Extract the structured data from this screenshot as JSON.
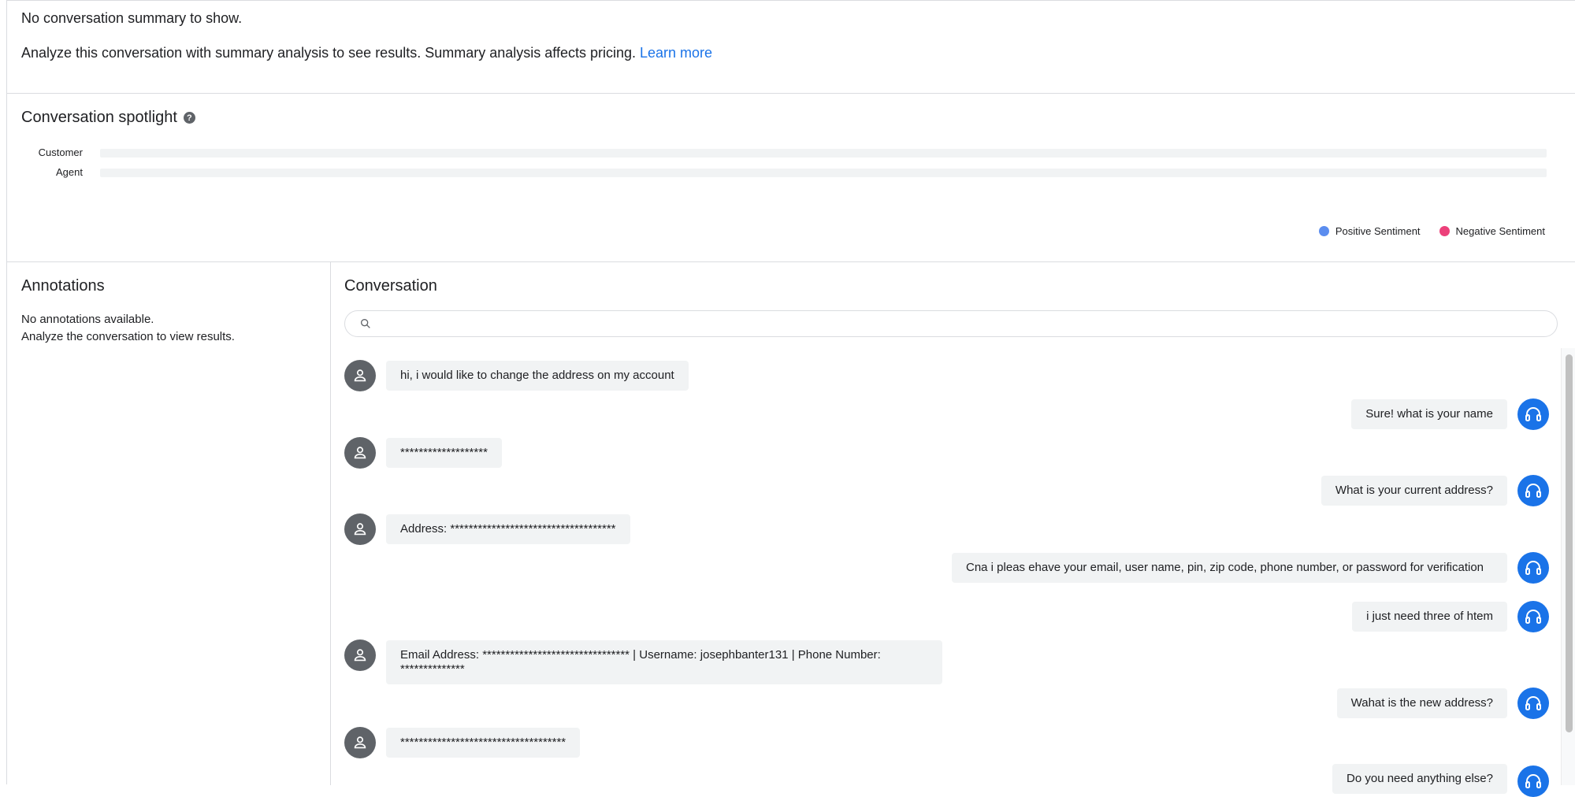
{
  "summary": {
    "empty_text": "No conversation summary to show.",
    "hint_text": "Analyze this conversation with summary analysis to see results. Summary analysis affects pricing.",
    "learn_more": "Learn more"
  },
  "spotlight": {
    "title": "Conversation spotlight",
    "tracks": [
      "Customer",
      "Agent"
    ],
    "legend": [
      {
        "label": "Positive Sentiment",
        "color": "#5b8def"
      },
      {
        "label": "Negative Sentiment",
        "color": "#ec407a"
      }
    ]
  },
  "annotations": {
    "title": "Annotations",
    "line1": "No annotations available.",
    "line2": "Analyze the conversation to view results."
  },
  "conversation": {
    "title": "Conversation",
    "search_placeholder": "",
    "messages": [
      {
        "role": "customer",
        "text": "hi, i would like to change the address on my account"
      },
      {
        "role": "agent",
        "text": "Sure! what is your name"
      },
      {
        "role": "customer",
        "text": "*******************"
      },
      {
        "role": "agent",
        "text": "What is your current address?"
      },
      {
        "role": "customer",
        "text": "Address: ************************************"
      },
      {
        "role": "agent",
        "text": "Cna i pleas ehave your email, user name, pin, zip code, phone number, or password for verification"
      },
      {
        "role": "agent",
        "text": "i just need three of htem"
      },
      {
        "role": "customer",
        "text": "Email Address: ******************************** | Username: josephbanter131 | Phone Number: **************"
      },
      {
        "role": "agent",
        "text": "Wahat is the new address?"
      },
      {
        "role": "customer",
        "text": "************************************"
      },
      {
        "role": "agent",
        "text": "Do you need anything else?"
      }
    ]
  }
}
